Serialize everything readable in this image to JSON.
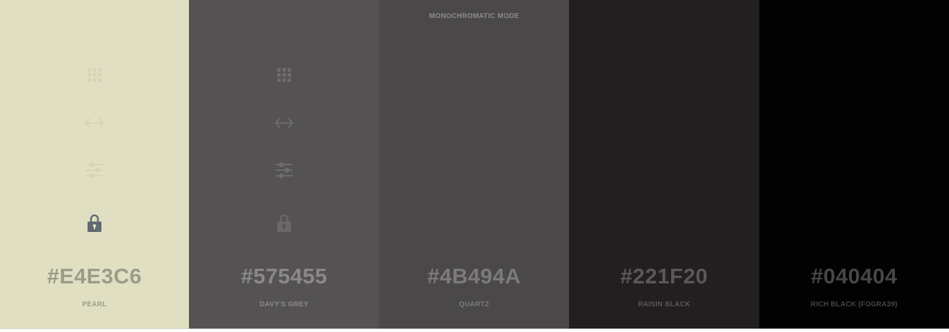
{
  "mode_label": "MONOCHROMATIC MODE",
  "swatches": [
    {
      "hex": "#E4E3C6",
      "name": "PEARL",
      "bg": "#E1DFC2",
      "hex_color": "#9c9b8a",
      "name_color": "#9c9b8a",
      "icon_color": "#d6d4b6",
      "lock_color": "#5f6a72"
    },
    {
      "hex": "#575455",
      "name": "DAVY'S GREY",
      "bg": "#545253",
      "hex_color": "#8b8889",
      "name_color": "#8b8889",
      "icon_color": "#6f6c6d",
      "lock_color": "#6a6768"
    },
    {
      "hex": "#4B494A",
      "name": "QUARTZ",
      "bg": "#4A4849",
      "hex_color": "#7c7a7b",
      "name_color": "#7c7a7b"
    },
    {
      "hex": "#221F20",
      "name": "RAISIN BLACK",
      "bg": "#221F20",
      "hex_color": "#5a5758",
      "name_color": "#5a5758"
    },
    {
      "hex": "#040404",
      "name": "RICH BLACK (FOGRA39)",
      "bg": "#020202",
      "hex_color": "#474747",
      "name_color": "#474747"
    }
  ],
  "icons": {
    "palette": "grid-icon",
    "resize": "double-arrow-icon",
    "adjust": "sliders-icon",
    "lock": "lock-icon"
  }
}
